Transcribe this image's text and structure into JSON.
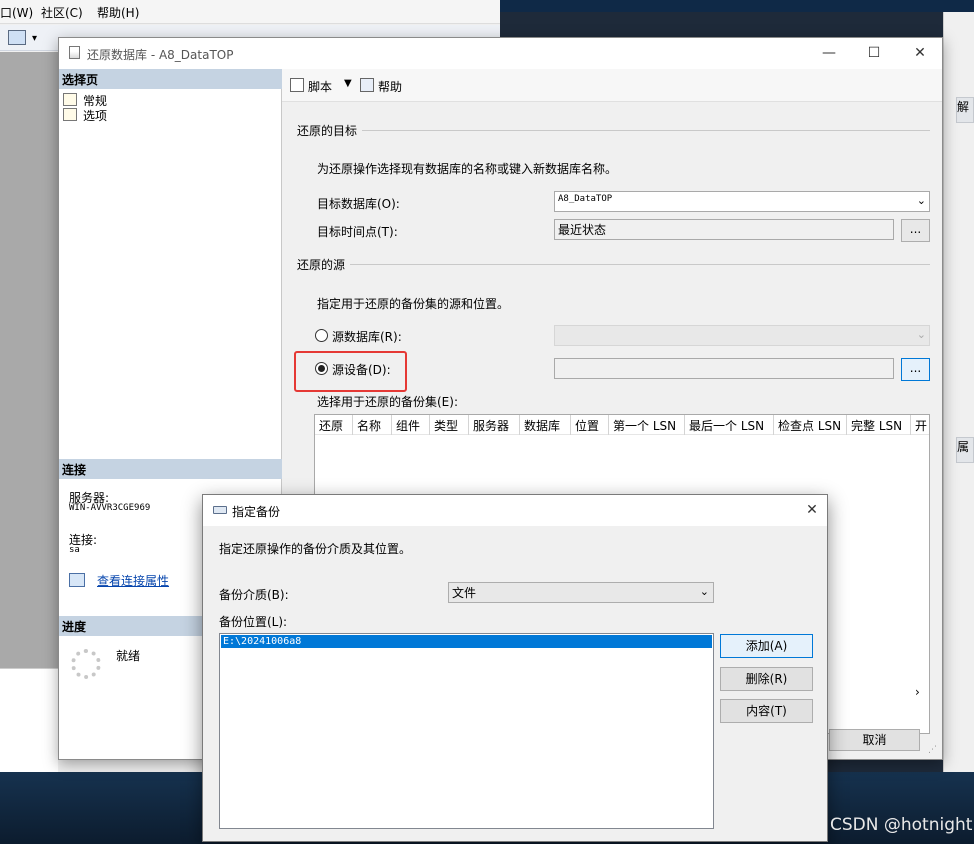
{
  "ssms": {
    "menu": [
      "口(W)",
      "社区(C)",
      "帮助(H)"
    ],
    "right_tabs": [
      "解",
      "属"
    ]
  },
  "restore_dialog": {
    "title": "还原数据库 - A8_DataTOP",
    "left": {
      "select_page_header": "选择页",
      "pages": [
        "常规",
        "选项"
      ],
      "connection_header": "连接",
      "server_label": "服务器:",
      "server_value": "WIN-AVVR3CGE969",
      "conn_label": "连接:",
      "conn_value": "sa",
      "view_props_link": "查看连接属性",
      "progress_header": "进度",
      "progress_status": "就绪"
    },
    "toolbar": {
      "script": "脚本",
      "help": "帮助"
    },
    "target": {
      "group": "还原的目标",
      "desc": "为还原操作选择现有数据库的名称或键入新数据库名称。",
      "db_label": "目标数据库(O):",
      "db_value": "A8_DataTOP",
      "time_label": "目标时间点(T):",
      "time_value": "最近状态",
      "dots": "..."
    },
    "source": {
      "group": "还原的源",
      "desc": "指定用于还原的备份集的源和位置。",
      "from_db": "源数据库(R):",
      "from_device": "源设备(D):",
      "selected": "from_device",
      "dots": "..."
    },
    "grid": {
      "label": "选择用于还原的备份集(E):",
      "columns": [
        "还原",
        "名称",
        "组件",
        "类型",
        "服务器",
        "数据库",
        "位置",
        "第一个 LSN",
        "最后一个 LSN",
        "检查点 LSN",
        "完整 LSN",
        "开"
      ]
    },
    "cancel_button": "取消"
  },
  "specify_dialog": {
    "title": "指定备份",
    "desc": "指定还原操作的备份介质及其位置。",
    "media_label": "备份介质(B):",
    "media_value": "文件",
    "location_label": "备份位置(L):",
    "locations": [
      "E:\\20241006a8"
    ],
    "add_button": "添加(A)",
    "remove_button": "删除(R)",
    "contents_button": "内容(T)"
  },
  "watermark": "CSDN @hotnight",
  "colors": {
    "highlight_box": "#e53935",
    "selection": "#0078d7"
  }
}
